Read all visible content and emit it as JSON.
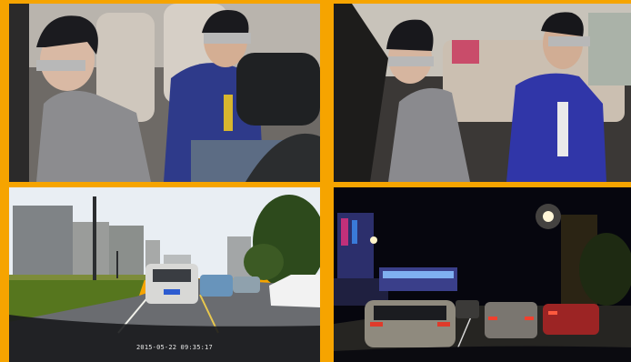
{
  "panels": [
    {
      "id": "cabin-driver-view",
      "kind": "in-cab camera, driver on phone and passenger"
    },
    {
      "id": "cabin-rear-view",
      "kind": "in-cab camera, two rear passengers"
    },
    {
      "id": "road-day-view",
      "kind": "forward dashcam, daytime city traffic"
    },
    {
      "id": "road-night-view",
      "kind": "forward dashcam, nighttime traffic"
    }
  ],
  "overlays": {
    "day_timestamp": "2015-05-22 09:35:17"
  },
  "colors": {
    "frame_border": "#f6a400",
    "night_sky": "#06060e",
    "day_sky": "#e9eef3"
  }
}
